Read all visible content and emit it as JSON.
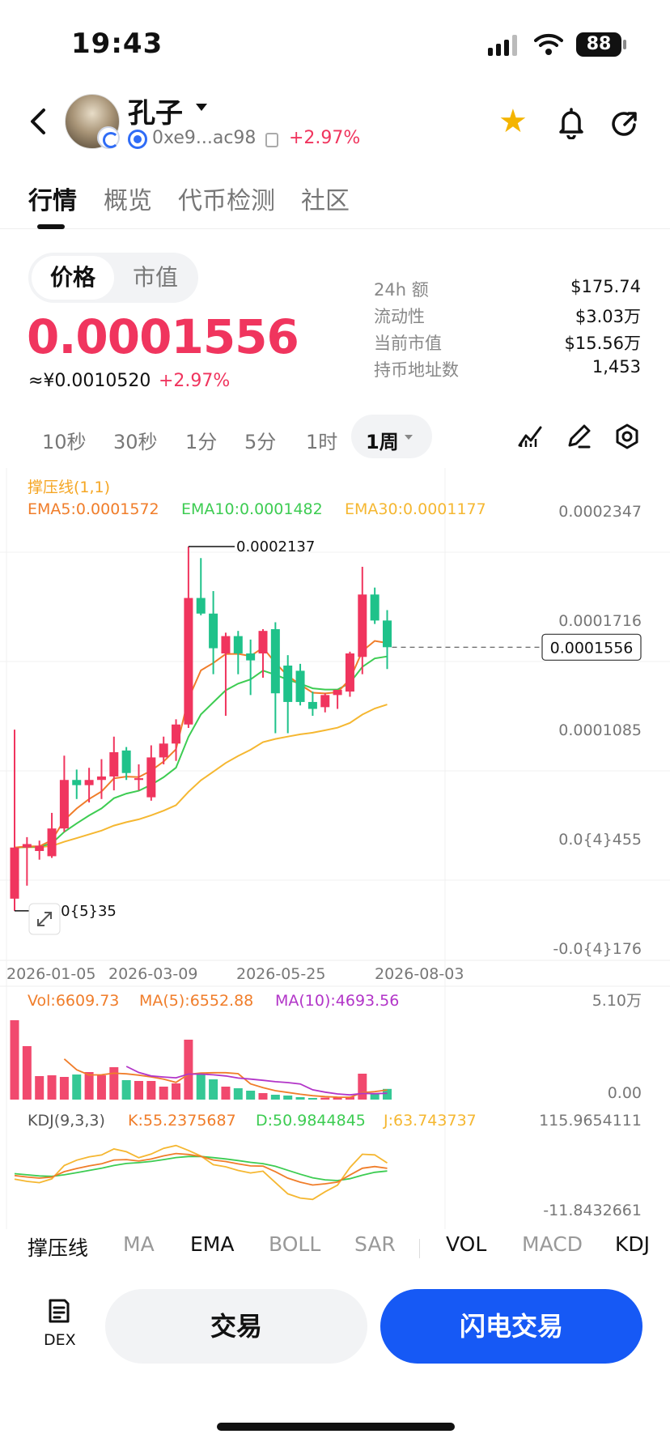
{
  "status_bar": {
    "time": "19:43",
    "battery": "88"
  },
  "header": {
    "token_name": "孔子",
    "address": "0xe9...ac98",
    "change": "+2.97%",
    "icons": [
      "back-icon",
      "avatar",
      "chain-icon",
      "copy-icon",
      "star-icon",
      "bell-icon",
      "share-icon"
    ]
  },
  "tabs": [
    "行情",
    "概览",
    "代币检测",
    "社区"
  ],
  "price_toggle": {
    "active": "价格",
    "inactive": "市值"
  },
  "price": {
    "value": "0.0001556",
    "cny": "≈¥0.0010520",
    "change": "+2.97%"
  },
  "stats": [
    {
      "label": "24h  额",
      "value": "$175.74"
    },
    {
      "label": "流动性",
      "value": "$3.03万"
    },
    {
      "label": "当前市值",
      "value": "$15.56万"
    },
    {
      "label": "持币地址数",
      "value": "1,453"
    }
  ],
  "intervals": [
    "10秒",
    "30秒",
    "1分",
    "5分",
    "1时"
  ],
  "interval_selected": "1周",
  "colors": {
    "up": "#f0355e",
    "down": "#1fc28a",
    "ema5": "#f07d2a",
    "ema10": "#3dcc52",
    "ema30": "#f5b731",
    "ma10": "#b235c8",
    "accent": "#1659f5"
  },
  "chart_data": {
    "type": "candlestick",
    "indicator_title": "撑压线(1,1)",
    "ema_labels": {
      "ema5": "EMA5:0.0001572",
      "ema10": "EMA10:0.0001482",
      "ema30": "EMA30:0.0001177"
    },
    "y_ticks": [
      "0.0002347",
      "0.0001716",
      "0.0001085",
      "0.0{4}455",
      "-0.0{4}176"
    ],
    "x_ticks": [
      "2026-01-05",
      "2026-03-09",
      "2026-05-25",
      "2026-08-03"
    ],
    "high_label": "0.0002137",
    "low_label": "0.0{5}35",
    "current_price": "0.0001556",
    "ylim": [
      -1.76e-05,
      0.0002347
    ],
    "candles": [
      {
        "o": 1.05e-05,
        "h": 0.000108,
        "l": 3.5e-06,
        "c": 4e-05
      },
      {
        "o": 4e-05,
        "h": 4.6e-05,
        "l": 1.8e-05,
        "c": 4.2e-05
      },
      {
        "o": 3.8e-05,
        "h": 4.4e-05,
        "l": 3.3e-05,
        "c": 4.1e-05
      },
      {
        "o": 3.5e-05,
        "h": 6e-05,
        "l": 3.4e-05,
        "c": 5.1e-05
      },
      {
        "o": 5.1e-05,
        "h": 9.3e-05,
        "l": 4.9e-05,
        "c": 7.9e-05
      },
      {
        "o": 7.9e-05,
        "h": 8.5e-05,
        "l": 6.8e-05,
        "c": 7.6e-05
      },
      {
        "o": 7.6e-05,
        "h": 8.6e-05,
        "l": 6.6e-05,
        "c": 7.9e-05
      },
      {
        "o": 7.9e-05,
        "h": 9.1e-05,
        "l": 6.8e-05,
        "c": 8.1e-05
      },
      {
        "o": 8.1e-05,
        "h": 0.000104,
        "l": 7.3e-05,
        "c": 9.5e-05
      },
      {
        "o": 9.6e-05,
        "h": 9.8e-05,
        "l": 7.9e-05,
        "c": 8.3e-05
      },
      {
        "o": 7.9e-05,
        "h": 8.8e-05,
        "l": 7.3e-05,
        "c": 8e-05
      },
      {
        "o": 6.9e-05,
        "h": 9.9e-05,
        "l": 6.7e-05,
        "c": 9.2e-05
      },
      {
        "o": 9.2e-05,
        "h": 0.000104,
        "l": 8.8e-05,
        "c": 0.0001
      },
      {
        "o": 0.0001,
        "h": 0.000114,
        "l": 9e-05,
        "c": 0.000111
      },
      {
        "o": 0.000111,
        "h": 0.0002137,
        "l": 0.000109,
        "c": 0.000184
      },
      {
        "o": 0.000184,
        "h": 0.000207,
        "l": 0.000174,
        "c": 0.000175
      },
      {
        "o": 0.000175,
        "h": 0.000188,
        "l": 0.00014,
        "c": 0.000155
      },
      {
        "o": 0.000152,
        "h": 0.000164,
        "l": 0.000116,
        "c": 0.000162
      },
      {
        "o": 0.000162,
        "h": 0.000165,
        "l": 0.00014,
        "c": 0.000152
      },
      {
        "o": 0.000152,
        "h": 0.00016,
        "l": 0.000128,
        "c": 0.000148
      },
      {
        "o": 0.000152,
        "h": 0.000166,
        "l": 0.000138,
        "c": 0.000165
      },
      {
        "o": 0.000166,
        "h": 0.00017,
        "l": 0.000106,
        "c": 0.000129
      },
      {
        "o": 0.000145,
        "h": 0.000151,
        "l": 0.000106,
        "c": 0.000124
      },
      {
        "o": 0.000142,
        "h": 0.000146,
        "l": 0.000122,
        "c": 0.000124
      },
      {
        "o": 0.000124,
        "h": 0.00013,
        "l": 0.000116,
        "c": 0.00012
      },
      {
        "o": 0.000121,
        "h": 0.000129,
        "l": 0.000118,
        "c": 0.000128
      },
      {
        "o": 0.000128,
        "h": 0.000131,
        "l": 0.00012,
        "c": 0.000131
      },
      {
        "o": 0.00013,
        "h": 0.000153,
        "l": 0.000127,
        "c": 0.000152
      },
      {
        "o": 0.00015,
        "h": 0.000202,
        "l": 0.00014,
        "c": 0.000186
      },
      {
        "o": 0.000186,
        "h": 0.00019,
        "l": 0.000169,
        "c": 0.000171
      },
      {
        "o": 0.000171,
        "h": 0.000177,
        "l": 0.000143,
        "c": 0.0001556
      }
    ],
    "volume": {
      "labels": {
        "vol": "Vol:6609.73",
        "ma5": "MA(5):6552.88",
        "ma10": "MA(10):4693.56"
      },
      "y_ticks": [
        "5.10万",
        "0.00"
      ],
      "ylim": [
        0,
        51000
      ],
      "values": [
        49000,
        33000,
        14500,
        15000,
        14000,
        15500,
        17000,
        15000,
        20000,
        12000,
        11500,
        11500,
        8000,
        10000,
        37000,
        15500,
        12500,
        8000,
        7000,
        5500,
        4000,
        3000,
        2500,
        1500,
        1000,
        1200,
        1400,
        1800,
        16000,
        4000,
        6600
      ]
    },
    "kdj": {
      "labels": {
        "title": "KDJ(9,3,3)",
        "k": "K:55.2375687",
        "d": "D:50.9844845",
        "j": "J:63.743737"
      },
      "y_ticks": [
        "115.9654111",
        "-11.8432661"
      ],
      "ylim": [
        -11.8432661,
        115.9654111
      ]
    }
  },
  "indicator_tabs": [
    "撑压线",
    "MA",
    "EMA",
    "BOLL",
    "SAR",
    "VOL",
    "MACD",
    "KDJ"
  ],
  "indicator_tabs_on": [
    "撑压线",
    "EMA",
    "VOL",
    "KDJ"
  ],
  "bottom": {
    "dex_label": "DEX",
    "trade": "交易",
    "flash_trade": "闪电交易"
  }
}
